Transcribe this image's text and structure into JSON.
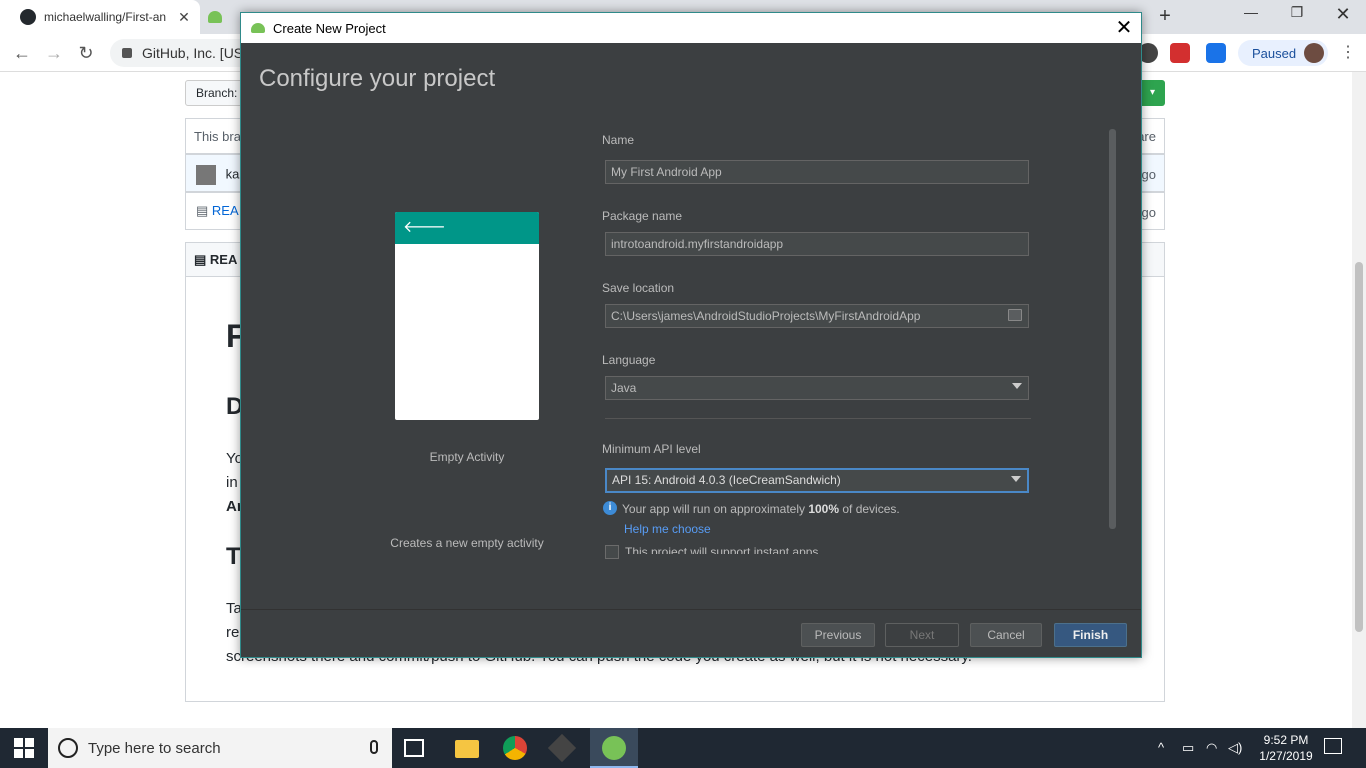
{
  "browser": {
    "active_tab_title": "michaelwalling/First-an",
    "address": "GitHub, Inc. [US",
    "profile_status": "Paused"
  },
  "github": {
    "branch_label": "Branch:",
    "box1_text": "This bra",
    "box1_right": "are",
    "commit_user": "kab",
    "commit_right": "go",
    "readme_link": "REA",
    "readme_right": "go",
    "readme_header": "REA",
    "h1": "F",
    "h2a": "D",
    "para1_l1": "Yo",
    "para1_l2": "in",
    "para1_l3": "Ar",
    "h2b": "T",
    "para2_l1": "Ta",
    "para2_l2": "re",
    "para2_l3": "screenshots there and commit/push to GitHub. You can push the code you create as well, but it is not necessary."
  },
  "dialog": {
    "window_title": "Create New Project",
    "heading": "Configure your project",
    "activity_name": "Empty Activity",
    "activity_desc": "Creates a new empty activity",
    "fields": {
      "name_label": "Name",
      "name_value": "My First Android App",
      "package_label": "Package name",
      "package_value": "introtoandroid.myfirstandroidapp",
      "location_label": "Save location",
      "location_value": "C:\\Users\\james\\AndroidStudioProjects\\MyFirstAndroidApp",
      "language_label": "Language",
      "language_value": "Java",
      "api_label": "Minimum API level",
      "api_value": "API 15: Android 4.0.3 (IceCreamSandwich)"
    },
    "info_prefix": "Your app will run on approximately ",
    "info_percent": "100%",
    "info_suffix": " of devices.",
    "help_link": "Help me choose",
    "instant_apps_label": "This project will support instant apps",
    "buttons": {
      "previous": "Previous",
      "next": "Next",
      "cancel": "Cancel",
      "finish": "Finish"
    }
  },
  "taskbar": {
    "search_placeholder": "Type here to search",
    "time": "9:52 PM",
    "date": "1/27/2019"
  },
  "colors": {
    "dialog_bg": "#3c3f41",
    "accent_teal": "#009688",
    "finish_button": "#365880",
    "link": "#589df6"
  }
}
